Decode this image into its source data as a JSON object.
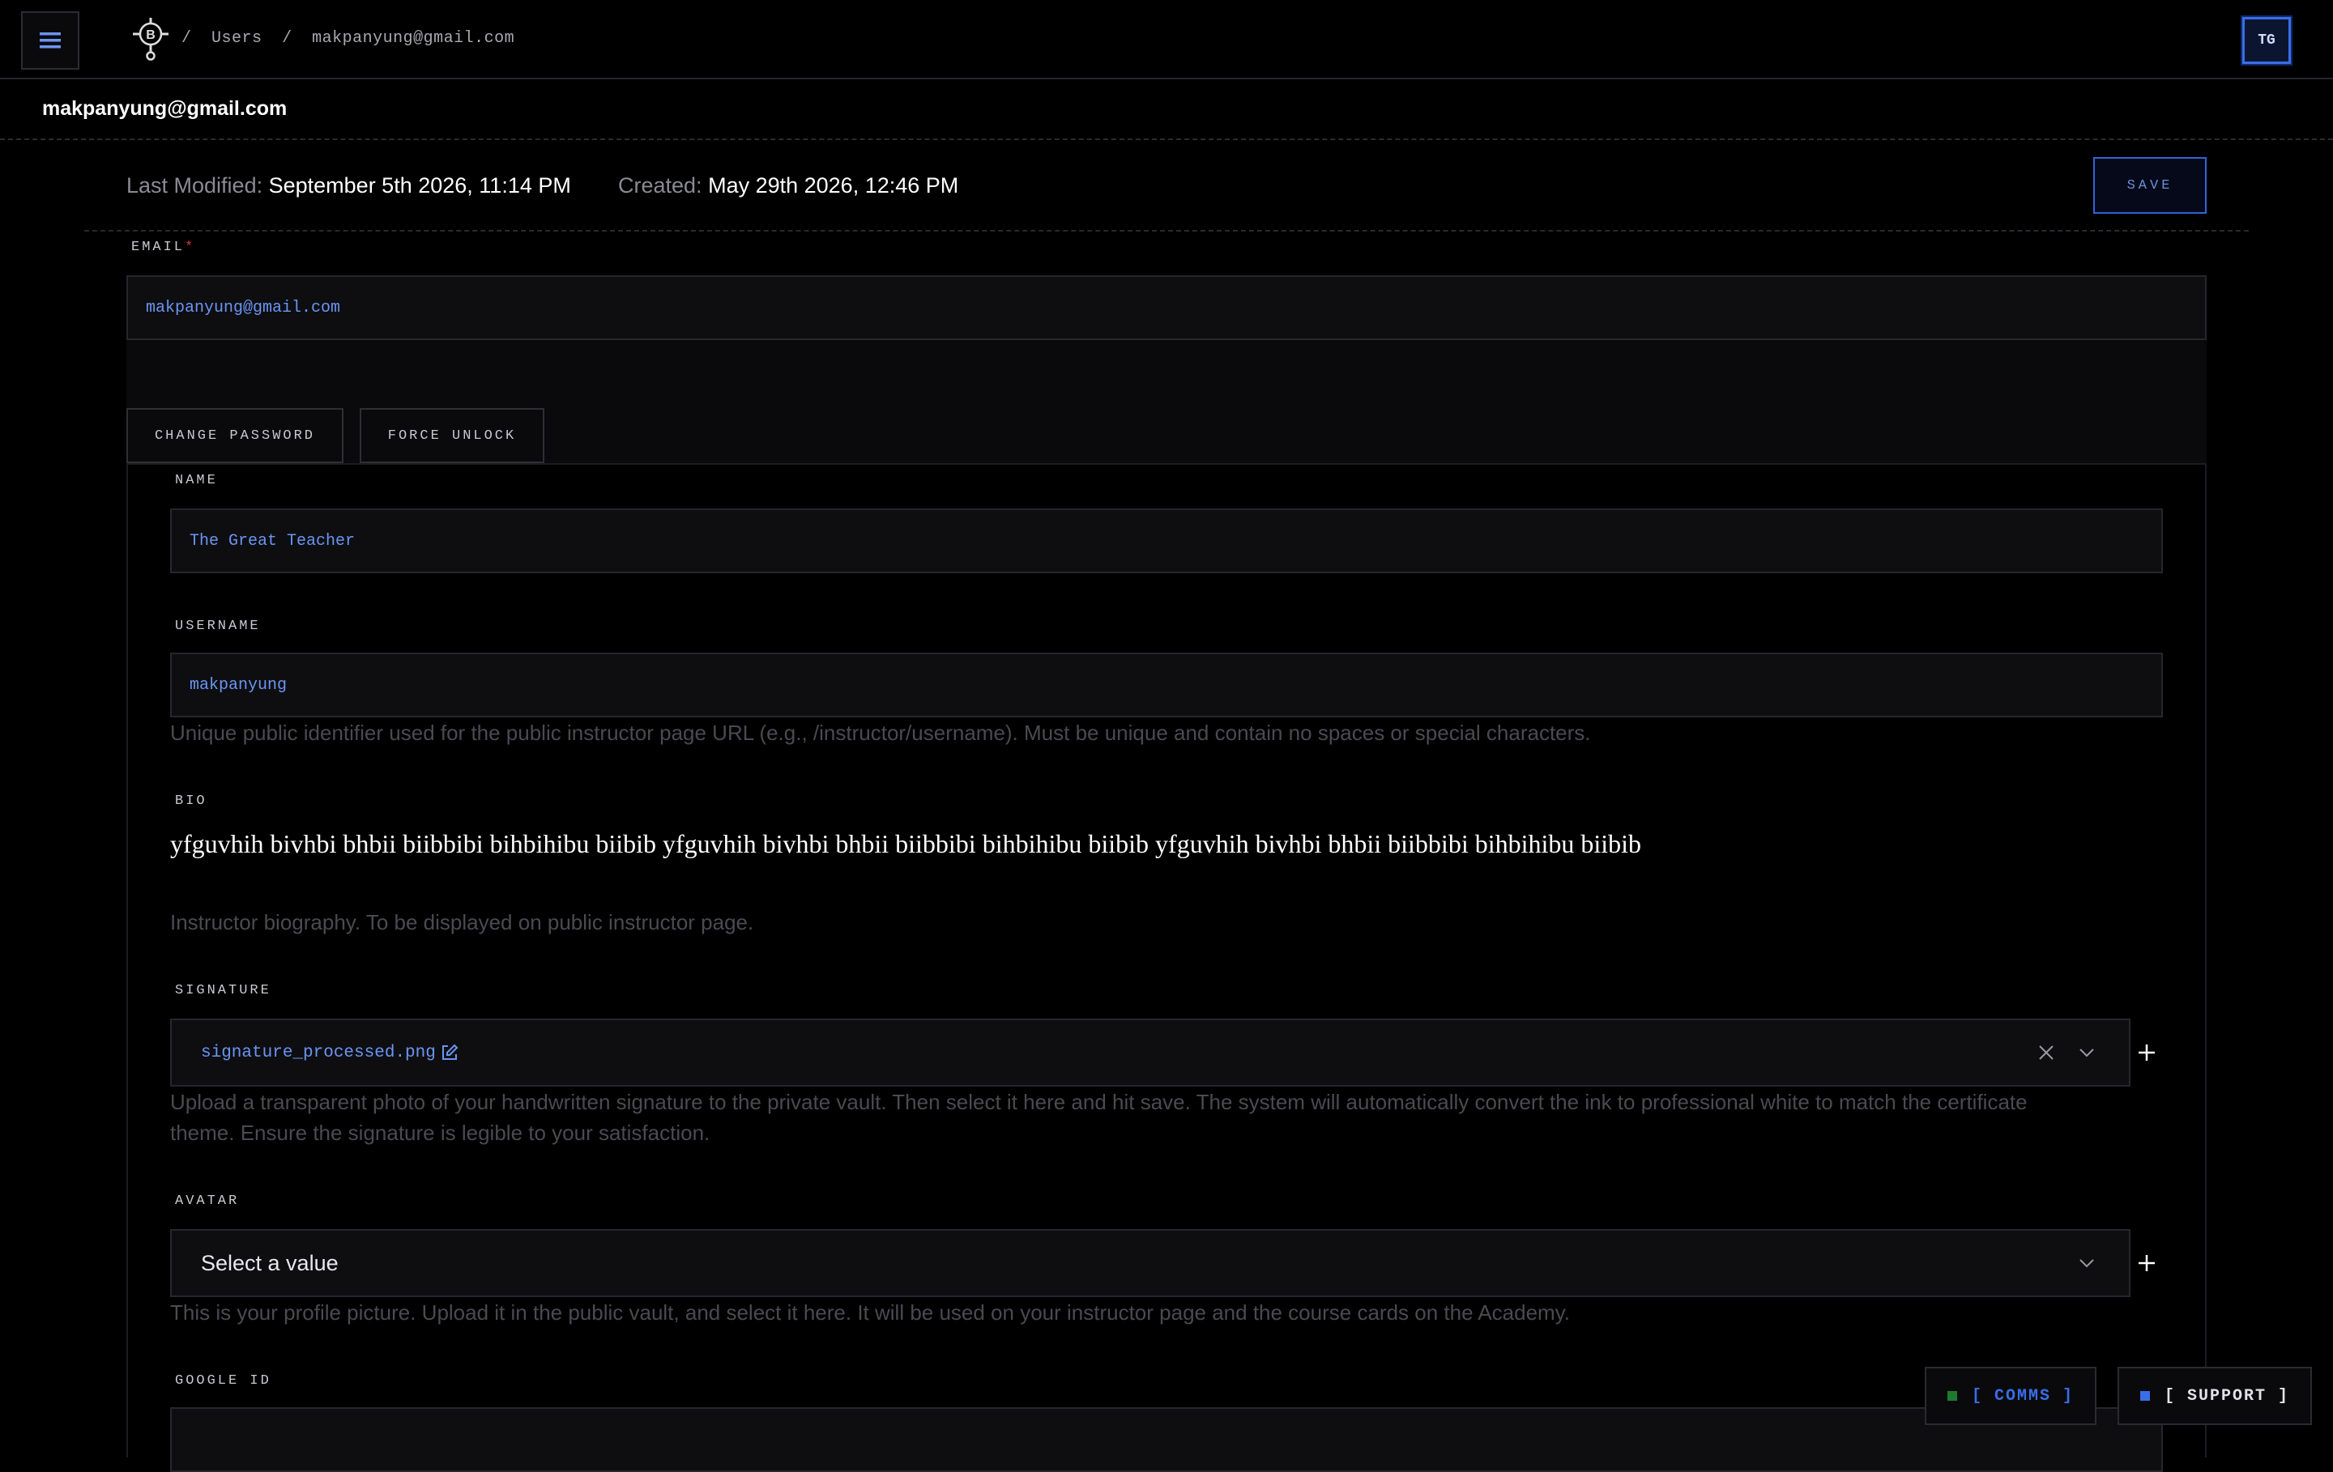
{
  "header": {
    "breadcrumbs": [
      "/",
      "Users",
      "/",
      "makpanyung@gmail.com"
    ],
    "user_initials": "TG"
  },
  "page": {
    "title": "makpanyung@gmail.com",
    "last_modified_label": "Last Modified:",
    "last_modified_value": "September 5th 2026, 11:14 PM",
    "created_label": "Created:",
    "created_value": "May 29th 2026, 12:46 PM",
    "save_label": "SAVE"
  },
  "email": {
    "label": "EMAIL",
    "required_mark": "*",
    "value": "makpanyung@gmail.com"
  },
  "actions": {
    "change_password": "CHANGE PASSWORD",
    "force_unlock": "FORCE UNLOCK"
  },
  "name": {
    "label": "NAME",
    "value": "The Great Teacher"
  },
  "username": {
    "label": "USERNAME",
    "value": "makpanyung",
    "help": "Unique public identifier used for the public instructor page URL (e.g., /instructor/username). Must be unique and contain no spaces or special characters."
  },
  "bio": {
    "label": "BIO",
    "value": "yfguvhih bivhbi bhbii biibbibi bihbihibu biibib yfguvhih bivhbi bhbii biibbibi bihbihibu biibib yfguvhih bivhbi bhbii biibbibi bihbihibu biibib",
    "help": "Instructor biography. To be displayed on public instructor page."
  },
  "signature": {
    "label": "SIGNATURE",
    "value": "signature_processed.png",
    "help_line1": "Upload a transparent photo of your handwritten signature to the private vault. Then select it here and hit save. The system will automatically convert the ink to professional white to match the certificate",
    "help_line2": "theme. Ensure the signature is legible to your satisfaction."
  },
  "avatar": {
    "label": "AVATAR",
    "placeholder": "Select a value",
    "help": "This is your profile picture. Upload it in the public vault, and select it here. It will be used on your instructor page and the course cards on the Academy."
  },
  "google_id": {
    "label": "GOOGLE ID"
  },
  "floating": {
    "comms": "[ COMMS ]",
    "support": "[ SUPPORT ]"
  },
  "colors": {
    "accent": "#3a6ee8",
    "input_text": "#6b95f2",
    "comms_indicator": "#1e7a2e",
    "support_indicator": "#3a6ee8"
  },
  "icons": [
    "menu-icon",
    "logo-icon",
    "edit-icon",
    "clear-icon",
    "chevron-down-icon",
    "plus-icon"
  ]
}
